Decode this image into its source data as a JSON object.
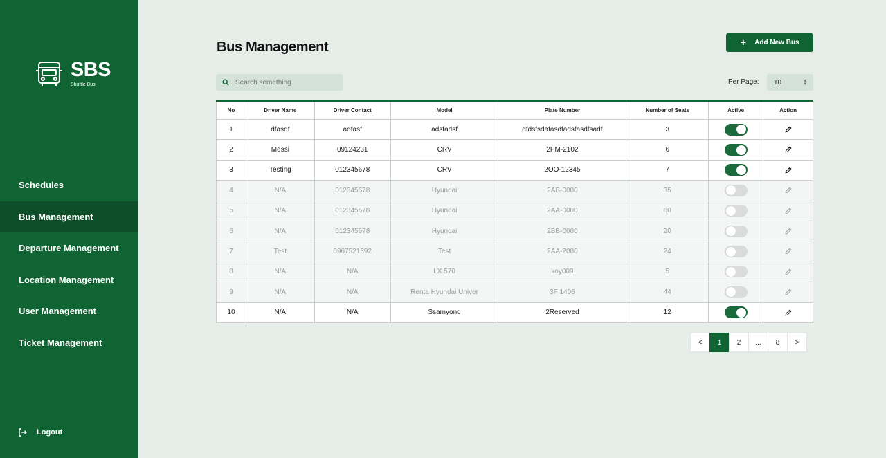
{
  "brand": {
    "title": "SBS",
    "subtitle": "Shuttle Bus"
  },
  "sidebar": {
    "items": [
      {
        "label": "Schedules",
        "active": false
      },
      {
        "label": "Bus Management",
        "active": true
      },
      {
        "label": "Departure Management",
        "active": false
      },
      {
        "label": "Location Management",
        "active": false
      },
      {
        "label": "User Management",
        "active": false
      },
      {
        "label": "Ticket Management",
        "active": false
      }
    ],
    "logout_label": "Logout"
  },
  "page": {
    "title": "Bus Management",
    "add_button_label": "Add New Bus"
  },
  "search": {
    "placeholder": "Search something",
    "value": ""
  },
  "per_page": {
    "label": "Per Page:",
    "value": "10"
  },
  "table": {
    "headers": [
      "No",
      "Driver Name",
      "Driver Contact",
      "Model",
      "Plate Number",
      "Number of Seats",
      "Active",
      "Action"
    ],
    "rows": [
      {
        "no": "1",
        "driver": "dfasdf",
        "contact": "adfasf",
        "model": "adsfadsf",
        "plate": "dfdsfsdafasdfadsfasdfsadf",
        "seats": "3",
        "active": true
      },
      {
        "no": "2",
        "driver": "Messi",
        "contact": "09124231",
        "model": "CRV",
        "plate": "2PM-2102",
        "seats": "6",
        "active": true
      },
      {
        "no": "3",
        "driver": "Testing",
        "contact": "012345678",
        "model": "CRV",
        "plate": "2OO-12345",
        "seats": "7",
        "active": true
      },
      {
        "no": "4",
        "driver": "N/A",
        "contact": "012345678",
        "model": "Hyundai",
        "plate": "2AB-0000",
        "seats": "35",
        "active": false
      },
      {
        "no": "5",
        "driver": "N/A",
        "contact": "012345678",
        "model": "Hyundai",
        "plate": "2AA-0000",
        "seats": "60",
        "active": false
      },
      {
        "no": "6",
        "driver": "N/A",
        "contact": "012345678",
        "model": "Hyundai",
        "plate": "2BB-0000",
        "seats": "20",
        "active": false
      },
      {
        "no": "7",
        "driver": "Test",
        "contact": "0967521392",
        "model": "Test",
        "plate": "2AA-2000",
        "seats": "24",
        "active": false
      },
      {
        "no": "8",
        "driver": "N/A",
        "contact": "N/A",
        "model": "LX 570",
        "plate": "koy009",
        "seats": "5",
        "active": false
      },
      {
        "no": "9",
        "driver": "N/A",
        "contact": "N/A",
        "model": "Renta Hyundai Univer",
        "plate": "3F 1406",
        "seats": "44",
        "active": false
      },
      {
        "no": "10",
        "driver": "N/A",
        "contact": "N/A",
        "model": "Ssamyong",
        "plate": "2Reserved",
        "seats": "12",
        "active": true
      }
    ]
  },
  "pagination": {
    "prev": "<",
    "pages": [
      "1",
      "2",
      "...",
      "8"
    ],
    "current": "1",
    "next": ">"
  },
  "colors": {
    "brand_green": "#106333",
    "active_nav": "#0c4f28",
    "background": "#e6ede8"
  },
  "icons": {
    "logo": "bus-icon",
    "search": "search-icon",
    "add": "plus-icon",
    "edit": "pencil-icon",
    "logout": "logout-icon"
  }
}
